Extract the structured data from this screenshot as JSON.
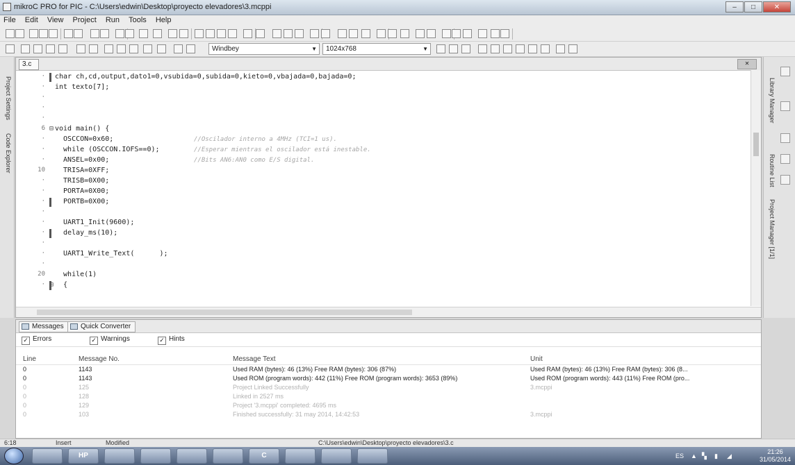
{
  "window": {
    "title": "mikroC PRO for PIC - C:\\Users\\edwin\\Desktop\\proyecto elevadores\\3.mcppi",
    "min": "–",
    "max": "□",
    "close": "✕"
  },
  "menu": [
    "File",
    "Edit",
    "View",
    "Project",
    "Run",
    "Tools",
    "Help"
  ],
  "toolbar2": {
    "theme": "Windbey",
    "resolution": "1024x768"
  },
  "left_dock": {
    "project_settings": "Project Settings",
    "code_explorer": "Code Explorer"
  },
  "right_dock": {
    "library_manager": "Library Manager",
    "routine_list": "Routine List",
    "project_manager": "Project Manager [1/1]"
  },
  "editor": {
    "tab": "3.c",
    "close": "✕",
    "lines": [
      {
        "n": "·",
        "text": "char ch,cd,output,dato1=0,vsubida=0,subida=0,kieto=0,vbajada=0,bajada=0;"
      },
      {
        "n": "·",
        "text": "int texto[7];"
      },
      {
        "n": "·",
        "text": ""
      },
      {
        "n": "·",
        "text": ""
      },
      {
        "n": "·",
        "text": ""
      },
      {
        "n": "6",
        "text": "void main() {"
      },
      {
        "n": "·",
        "text": "  OSCCON=0x60;",
        "comment": "//Oscilador interno a 4MHz (TCI=1 us)."
      },
      {
        "n": "·",
        "text": "  while (OSCCON.IOFS==0);",
        "comment": "//Esperar mientras el oscilador está inestable."
      },
      {
        "n": "·",
        "text": "  ANSEL=0x00;",
        "comment": "//Bits AN6:AN0 como E/S digital."
      },
      {
        "n": "10",
        "text": "  TRISA=0XFF;"
      },
      {
        "n": "·",
        "text": "  TRISB=0X00;"
      },
      {
        "n": "·",
        "text": "  PORTA=0X00;"
      },
      {
        "n": "·",
        "text": "  PORTB=0X00;"
      },
      {
        "n": "·",
        "text": ""
      },
      {
        "n": "·",
        "text": "  UART1_Init(9600);"
      },
      {
        "n": "·",
        "text": "  delay_ms(10);"
      },
      {
        "n": "·",
        "text": ""
      },
      {
        "n": "·",
        "text": "  UART1_Write_Text(      );"
      },
      {
        "n": "·",
        "text": ""
      },
      {
        "n": "20",
        "text": "  while(1)"
      },
      {
        "n": "·",
        "text": "  {"
      }
    ]
  },
  "panel": {
    "tabs": [
      "Messages",
      "Quick Converter"
    ],
    "filters": [
      {
        "label": "Errors",
        "checked": true
      },
      {
        "label": "Warnings",
        "checked": true
      },
      {
        "label": "Hints",
        "checked": true
      }
    ],
    "columns": [
      "Line",
      "Message No.",
      "Message Text",
      "Unit"
    ],
    "rows": [
      {
        "line": "0",
        "no": "1143",
        "text": "Used RAM (bytes): 46 (13%)  Free RAM (bytes): 306 (87%)",
        "unit": "Used RAM (bytes): 46 (13%)  Free RAM (bytes): 306 (8...",
        "dim": false
      },
      {
        "line": "0",
        "no": "1143",
        "text": "Used ROM (program words): 442 (11%)  Free ROM (program words): 3653 (89%)",
        "unit": "Used ROM (program words): 443 (11%)  Free ROM (pro...",
        "dim": false
      },
      {
        "line": "0",
        "no": "125",
        "text": "Project Linked Successfully",
        "unit": "3.mcppi",
        "dim": true
      },
      {
        "line": "0",
        "no": "128",
        "text": "Linked in 2527 ms",
        "unit": "",
        "dim": true
      },
      {
        "line": "0",
        "no": "129",
        "text": "Project '3.mcppi' completed: 4695 ms",
        "unit": "",
        "dim": true
      },
      {
        "line": "0",
        "no": "103",
        "text": "Finished successfully: 31 may 2014, 14:42:53",
        "unit": "3.mcppi",
        "dim": true
      }
    ]
  },
  "status": {
    "position": "6:18",
    "mode": "Insert",
    "state": "Modified",
    "path": "C:\\Users\\edwin\\Desktop\\proyecto elevadores\\3.c"
  },
  "taskbar": {
    "buttons": [
      "",
      "HP",
      "",
      "",
      "",
      "",
      "C",
      "",
      "",
      ""
    ],
    "language": "ES",
    "time": "21:26",
    "date": "31/05/2014"
  }
}
